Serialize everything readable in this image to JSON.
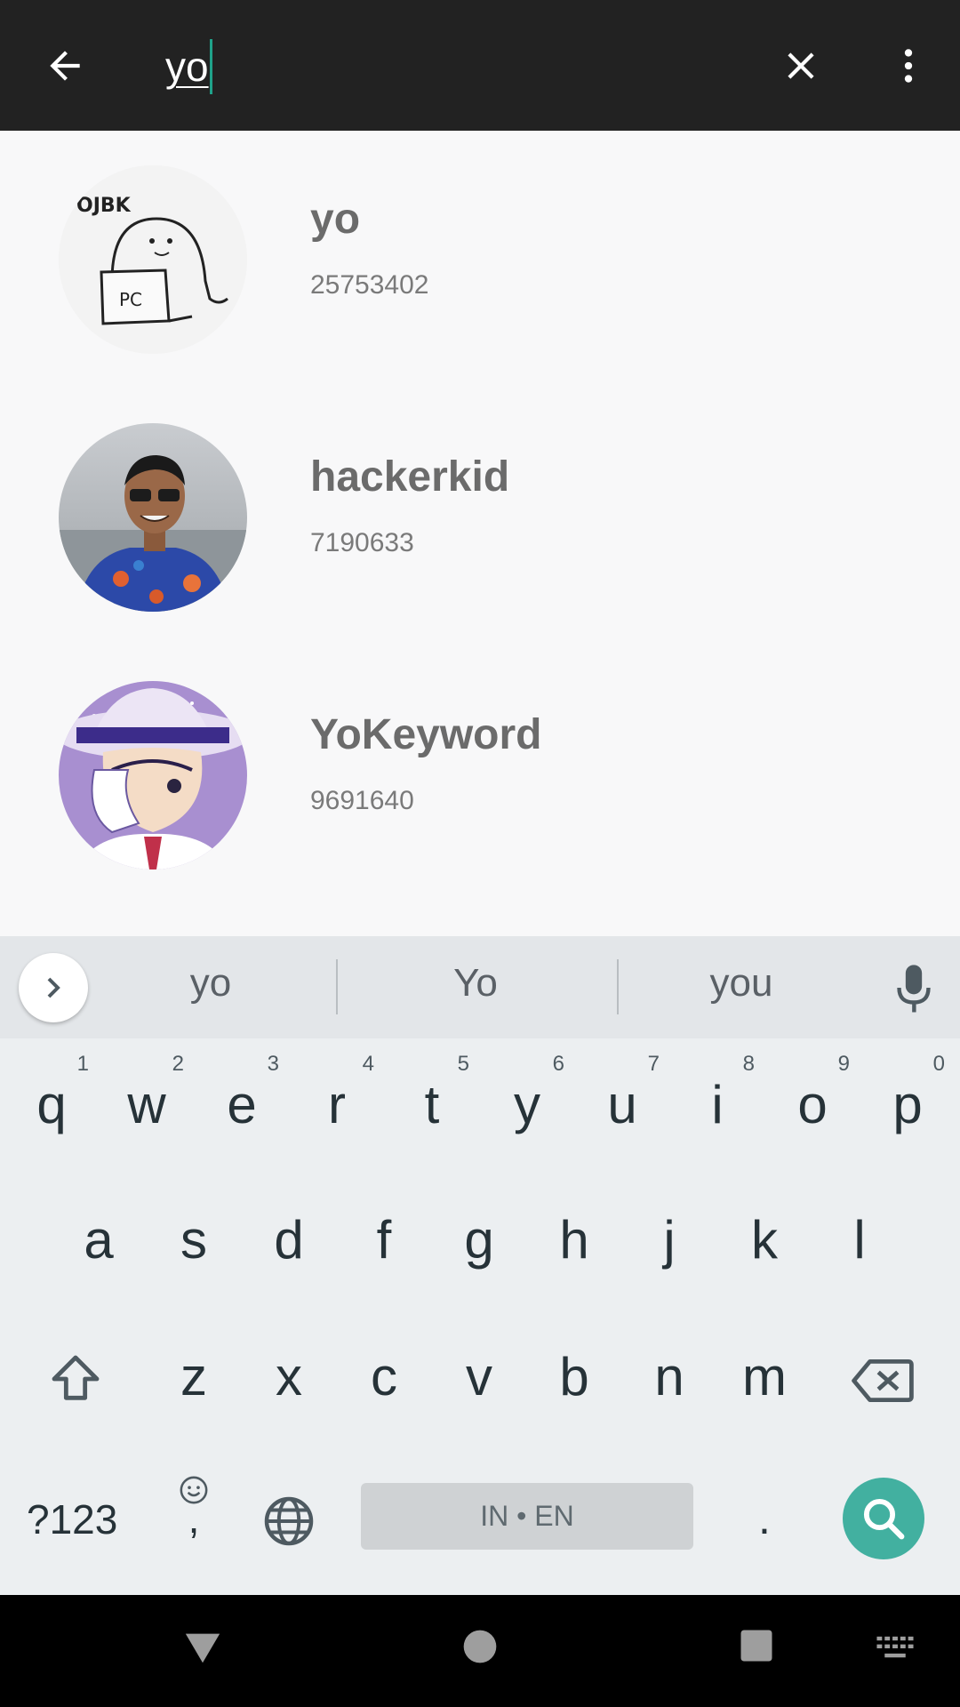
{
  "search": {
    "query": "yo"
  },
  "results": [
    {
      "name": "yo",
      "id": "25753402"
    },
    {
      "name": "hackerkid",
      "id": "7190633"
    },
    {
      "name": "YoKeyword",
      "id": "9691640"
    }
  ],
  "keyboard": {
    "suggestions": [
      "yo",
      "Yo",
      "you"
    ],
    "row1": [
      {
        "ch": "q",
        "num": "1"
      },
      {
        "ch": "w",
        "num": "2"
      },
      {
        "ch": "e",
        "num": "3"
      },
      {
        "ch": "r",
        "num": "4"
      },
      {
        "ch": "t",
        "num": "5"
      },
      {
        "ch": "y",
        "num": "6"
      },
      {
        "ch": "u",
        "num": "7"
      },
      {
        "ch": "i",
        "num": "8"
      },
      {
        "ch": "o",
        "num": "9"
      },
      {
        "ch": "p",
        "num": "0"
      }
    ],
    "row2": [
      "a",
      "s",
      "d",
      "f",
      "g",
      "h",
      "j",
      "k",
      "l"
    ],
    "row3": [
      "z",
      "x",
      "c",
      "v",
      "b",
      "n",
      "m"
    ],
    "symbols_label": "?123",
    "comma_label": ",",
    "period_label": ".",
    "space_label": "IN • EN"
  },
  "colors": {
    "topbar": "#222222",
    "caret": "#1fa28a",
    "search_key": "#42b0a0",
    "keyboard_bg": "#eceff1"
  }
}
